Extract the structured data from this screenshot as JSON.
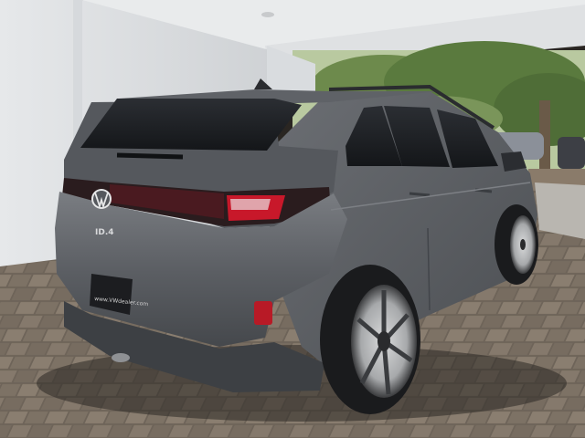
{
  "photo": {
    "subject": "Volkswagen ID.4 SUV",
    "vehicle": {
      "badge_text": "ID.4",
      "plate_frame_text": "www.VWdealer.com",
      "paint_color": "#5f6266"
    },
    "icons": [
      "vw-logo-icon"
    ]
  }
}
